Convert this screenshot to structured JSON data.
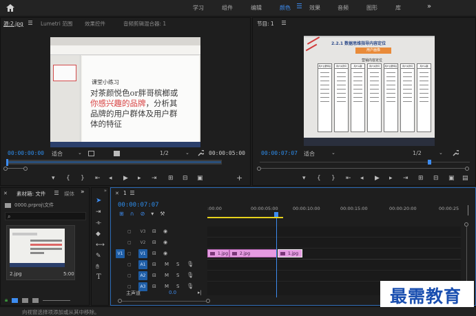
{
  "workspaces": {
    "items": [
      {
        "label": "学习"
      },
      {
        "label": "组件"
      },
      {
        "label": "编辑"
      },
      {
        "label": "颜色"
      },
      {
        "label": "效果"
      },
      {
        "label": "音频"
      },
      {
        "label": "图形"
      },
      {
        "label": "库"
      }
    ],
    "active": "颜色",
    "more": "»"
  },
  "source_panel": {
    "tabs": [
      "源:2.jpg",
      "Lumetri 范围",
      "效果控件",
      "音频剪辑混合器: 1"
    ],
    "timecode_left": "00:00:00:00",
    "fit_label": "适合",
    "scale": "1/2",
    "timecode_right": "00:00:05:00",
    "slide": {
      "title": "课堂小练习",
      "line1": "对茶颜悦色or胖哥槟榔或",
      "line2_red": "你感兴趣的品牌",
      "line2_rest": "，分析其",
      "line3": "品牌的用户群体及用户群",
      "line4": "体的特征"
    }
  },
  "program_panel": {
    "tab": "节目: 1",
    "timecode_left": "00:00:07:07",
    "fit_label": "适合",
    "scale": "1/2",
    "slide": {
      "title": "2.2.1 数据思维指导内容定位",
      "subtitle": "用户画像",
      "label": "营销内容定位",
      "headers": [
        "用户主要特征",
        "用户关键词",
        "用户兴趣",
        "用户关键词",
        "用户主要特征",
        "用户关键词",
        "用户兴趣"
      ]
    }
  },
  "project_panel": {
    "tab": "素材箱: 文件",
    "tab2": "媒体",
    "more": "»",
    "path": "0000.prproj\\文件",
    "item_name": "2.jpg",
    "item_duration": "5:00"
  },
  "timeline": {
    "tab": "1",
    "timecode": "00:00:07:07",
    "ruler": [
      ":00:00",
      "00:00:05:00",
      "00:00:10:00",
      "00:00:15:00",
      "00:00:20:00",
      "00:00:25"
    ],
    "video_tracks": [
      "V3",
      "V2",
      "V1"
    ],
    "audio_tracks": [
      "A1",
      "A2",
      "A3"
    ],
    "source_patch": "V1",
    "master_label": "主声道",
    "master_value": "0.0",
    "track_buttons": {
      "mute": "M",
      "solo": "S"
    },
    "clips": [
      "1.jpg",
      "2.jpg",
      "1.jpg"
    ]
  },
  "status_bar": {
    "message": "向视窗选择项添加或从其中移除。"
  },
  "watermark": "最需教育",
  "colors": {
    "accent": "#2d8ceb",
    "clip": "#e59be1",
    "playhead": "#3d8cf0",
    "work_area": "#e7d21c"
  }
}
